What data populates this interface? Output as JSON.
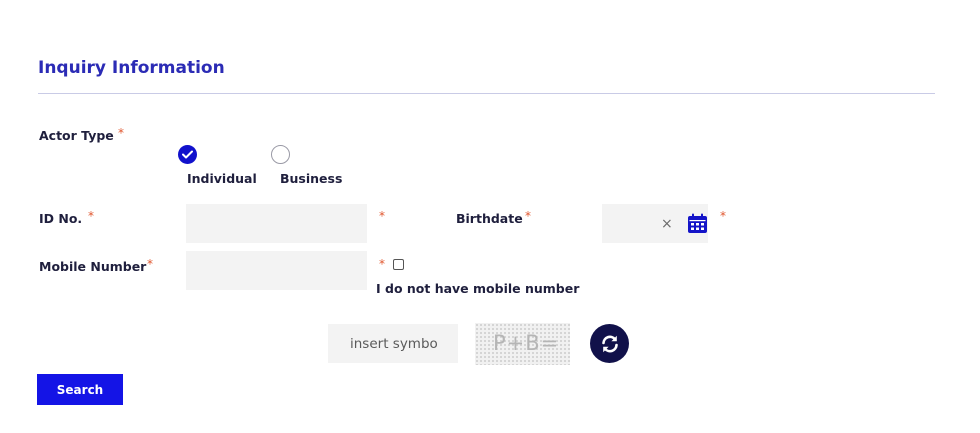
{
  "section": {
    "title": "Inquiry Information"
  },
  "required_mark": "*",
  "actor_type": {
    "label": "Actor Type",
    "options": [
      {
        "label": "Individual",
        "selected": true
      },
      {
        "label": "Business",
        "selected": false
      }
    ]
  },
  "id_no": {
    "label": "ID No.",
    "value": ""
  },
  "birthdate": {
    "label": "Birthdate",
    "value": "",
    "clear_icon": "close-icon",
    "calendar_icon": "calendar-icon"
  },
  "mobile": {
    "label": "Mobile Number",
    "value": "",
    "no_mobile_label": "I do not have mobile number",
    "no_mobile_checked": false
  },
  "captcha": {
    "placeholder": "insert symbo",
    "image_text": "P+B=",
    "refresh_icon": "refresh-icon"
  },
  "search_button": {
    "label": "Search"
  },
  "colors": {
    "accent": "#1414e6",
    "title": "#2b2bb5",
    "required": "#e0562e",
    "refresh_bg": "#11114a"
  }
}
